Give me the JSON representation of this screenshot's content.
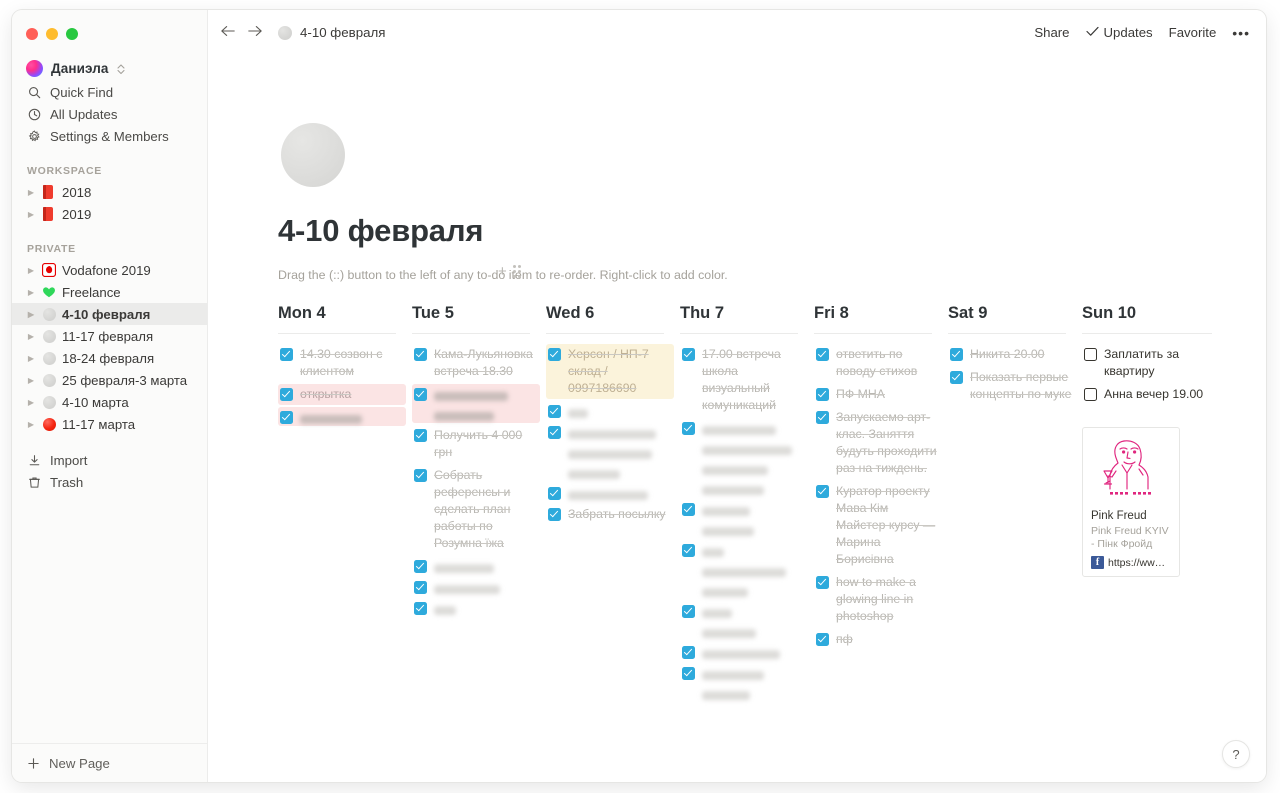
{
  "window": {
    "traffic_lights": [
      "close",
      "minimize",
      "zoom"
    ]
  },
  "sidebar": {
    "workspace_name": "Даниэла",
    "nav": [
      {
        "label": "Quick Find",
        "icon": "search-icon"
      },
      {
        "label": "All Updates",
        "icon": "clock-icon"
      },
      {
        "label": "Settings & Members",
        "icon": "gear-icon"
      }
    ],
    "workspace_section_label": "WORKSPACE",
    "workspace_pages": [
      {
        "label": "2018",
        "icon": "red-book-icon"
      },
      {
        "label": "2019",
        "icon": "red-book-icon"
      }
    ],
    "private_section_label": "PRIVATE",
    "private_pages": [
      {
        "label": "Vodafone 2019",
        "icon": "vodafone-icon",
        "selected": false
      },
      {
        "label": "Freelance",
        "icon": "green-heart-icon",
        "selected": false
      },
      {
        "label": "4-10 февраля",
        "icon": "gray-circle-icon",
        "selected": true
      },
      {
        "label": "11-17 февраля",
        "icon": "gray-circle-icon",
        "selected": false
      },
      {
        "label": "18-24 февраля",
        "icon": "gray-circle-icon",
        "selected": false
      },
      {
        "label": "25 февраля-3 марта",
        "icon": "gray-circle-icon",
        "selected": false
      },
      {
        "label": "4-10 марта",
        "icon": "gray-circle-icon",
        "selected": false
      },
      {
        "label": "11-17 марта",
        "icon": "red-circle-icon",
        "selected": false
      }
    ],
    "tools": [
      {
        "label": "Import",
        "icon": "import-icon"
      },
      {
        "label": "Trash",
        "icon": "trash-icon"
      }
    ],
    "footer": {
      "label": "New Page",
      "icon": "plus-icon"
    }
  },
  "topbar": {
    "back_icon": "arrow-left-icon",
    "forward_icon": "arrow-right-icon",
    "breadcrumb": "4-10 февраля",
    "breadcrumb_icon": "gray-circle-icon",
    "share_label": "Share",
    "updates_label": "Updates",
    "updates_icon": "check-icon",
    "favorite_label": "Favorite",
    "more_label": "•••"
  },
  "page": {
    "title": "4-10 февраля",
    "hint": "Drag the (::) button to the left of any to-do item to re-order. Right-click to add color.",
    "cover_icon": "gray-circle-page-icon"
  },
  "colors": {
    "checkbox_checked": "#2eaadc",
    "highlight_pink": "#fbe4e4",
    "highlight_yellow": "#fbf3db",
    "text_done": "#b9b7b2",
    "text_default": "#37352f"
  },
  "days": [
    {
      "header": "Mon 4",
      "todos": [
        {
          "text": "14.30 созвон с клиентом",
          "checked": true,
          "bg": "none",
          "redacted": false
        },
        {
          "text": "открытка",
          "checked": true,
          "bg": "pink",
          "redacted": false
        },
        {
          "text": "",
          "checked": true,
          "bg": "pink",
          "redacted": true,
          "redacted_widths": [
            62
          ]
        }
      ]
    },
    {
      "header": "Tue 5",
      "todos": [
        {
          "text": "Кама-Лукьяновка встреча 18.30",
          "checked": true,
          "bg": "none",
          "redacted": false,
          "hover_controls": true
        },
        {
          "text": "",
          "checked": true,
          "bg": "pink",
          "redacted": true,
          "redacted_widths": [
            74,
            60
          ]
        },
        {
          "text": "Получить 4 000 грн",
          "checked": true,
          "bg": "none",
          "redacted": false
        },
        {
          "text": "Собрать референсы и сделать план работы по Розумна їжа",
          "checked": true,
          "bg": "none",
          "redacted": false
        },
        {
          "text": "",
          "checked": true,
          "bg": "none",
          "redacted": true,
          "redacted_widths": [
            60
          ]
        },
        {
          "text": "",
          "checked": true,
          "bg": "none",
          "redacted": true,
          "redacted_widths": [
            66
          ]
        },
        {
          "text": "",
          "checked": true,
          "bg": "none",
          "redacted": true,
          "redacted_widths": [
            22
          ]
        }
      ]
    },
    {
      "header": "Wed 6",
      "todos": [
        {
          "text": "Херсон / НП-7 склад / 0997186690",
          "checked": true,
          "bg": "yellow",
          "redacted": false
        },
        {
          "text": "",
          "checked": true,
          "bg": "none",
          "redacted": true,
          "redacted_widths": [
            20
          ]
        },
        {
          "text": "",
          "checked": true,
          "bg": "none",
          "redacted": true,
          "redacted_widths": [
            88,
            84,
            52
          ]
        },
        {
          "text": "",
          "checked": true,
          "bg": "none",
          "redacted": true,
          "redacted_widths": [
            80
          ]
        },
        {
          "text": "Забрать посылку",
          "checked": true,
          "bg": "none",
          "redacted": false
        }
      ]
    },
    {
      "header": "Thu 7",
      "todos": [
        {
          "text": "17.00 встреча школа визуальный комуникаций",
          "checked": true,
          "bg": "none",
          "redacted": false
        },
        {
          "text": "",
          "checked": true,
          "bg": "none",
          "redacted": true,
          "redacted_widths": [
            74,
            90,
            66,
            62
          ]
        },
        {
          "text": "",
          "checked": true,
          "bg": "none",
          "redacted": true,
          "redacted_widths": [
            48,
            52
          ]
        },
        {
          "text": "",
          "checked": true,
          "bg": "none",
          "redacted": true,
          "redacted_widths": [
            22,
            84,
            46
          ]
        },
        {
          "text": "",
          "checked": true,
          "bg": "none",
          "redacted": true,
          "redacted_widths": [
            30,
            54
          ]
        },
        {
          "text": "",
          "checked": true,
          "bg": "none",
          "redacted": true,
          "redacted_widths": [
            78
          ]
        },
        {
          "text": "",
          "checked": true,
          "bg": "none",
          "redacted": true,
          "redacted_widths": [
            62,
            48
          ]
        }
      ]
    },
    {
      "header": "Fri 8",
      "todos": [
        {
          "text": "ответить по поводу стихов",
          "checked": true,
          "bg": "none",
          "redacted": false
        },
        {
          "text": "ПФ МНА",
          "checked": true,
          "bg": "none",
          "redacted": false
        },
        {
          "text": "Запускаемо арт-клас. Заняття будуть проходити раз на тиждень.",
          "checked": true,
          "bg": "none",
          "redacted": false
        },
        {
          "text": "Куратор проекту Мава Кім Майстер курсу — Марина Борисівна",
          "checked": true,
          "bg": "none",
          "redacted": false
        },
        {
          "text": "how to make a glowing line in photoshop",
          "checked": true,
          "bg": "none",
          "redacted": false
        },
        {
          "text": "пф",
          "checked": true,
          "bg": "none",
          "redacted": false
        }
      ]
    },
    {
      "header": "Sat 9",
      "todos": [
        {
          "text": "Никита 20.00",
          "checked": true,
          "bg": "none",
          "redacted": false
        },
        {
          "text": "Показать первые концепты по муке",
          "checked": true,
          "bg": "none",
          "redacted": false
        }
      ]
    },
    {
      "header": "Sun 10",
      "todos": [
        {
          "text": "Заплатить за квартиру",
          "checked": false,
          "bg": "none",
          "redacted": false
        },
        {
          "text": "Анна вечер 19.00",
          "checked": false,
          "bg": "none",
          "redacted": false
        }
      ],
      "link_card": {
        "title": "Pink Freud",
        "description": "Pink Freud KYIV - Пінк Фройд",
        "url": "https://ww…",
        "source_icon": "facebook-icon",
        "art_label": "PINK FREUD"
      }
    }
  ],
  "help": {
    "label": "?"
  }
}
